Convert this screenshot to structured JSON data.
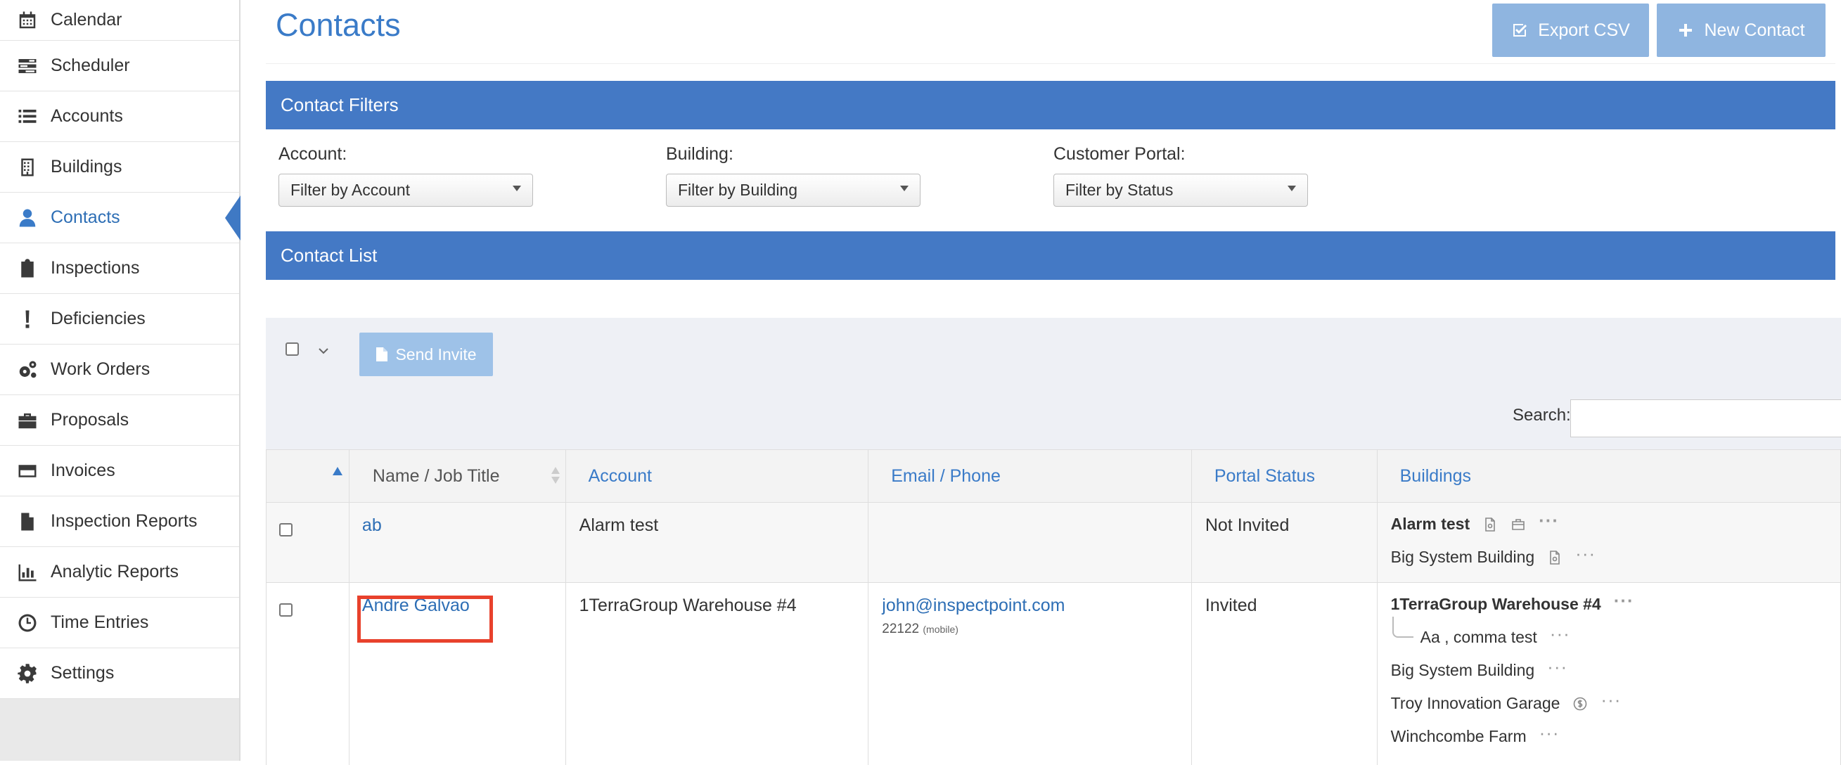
{
  "sidebar": {
    "items": [
      {
        "label": "Calendar",
        "icon": "calendar-icon"
      },
      {
        "label": "Scheduler",
        "icon": "scheduler-icon"
      },
      {
        "label": "Accounts",
        "icon": "list-icon"
      },
      {
        "label": "Buildings",
        "icon": "building-icon"
      },
      {
        "label": "Contacts",
        "icon": "user-icon",
        "active": true
      },
      {
        "label": "Inspections",
        "icon": "clipboard-icon"
      },
      {
        "label": "Deficiencies",
        "icon": "exclamation-icon"
      },
      {
        "label": "Work Orders",
        "icon": "gears-icon"
      },
      {
        "label": "Proposals",
        "icon": "briefcase-icon"
      },
      {
        "label": "Invoices",
        "icon": "credit-card-icon"
      },
      {
        "label": "Inspection Reports",
        "icon": "file-icon"
      },
      {
        "label": "Analytic Reports",
        "icon": "bar-chart-icon"
      },
      {
        "label": "Time Entries",
        "icon": "clock-icon"
      },
      {
        "label": "Settings",
        "icon": "gear-icon"
      }
    ]
  },
  "header": {
    "title": "Contacts",
    "export_label": "Export CSV",
    "new_label": "New Contact"
  },
  "filters": {
    "panel_title": "Contact Filters",
    "account": {
      "label": "Account:",
      "value": "Filter by Account"
    },
    "building": {
      "label": "Building:",
      "value": "Filter by Building"
    },
    "portal": {
      "label": "Customer Portal:",
      "value": "Filter by Status"
    }
  },
  "list": {
    "panel_title": "Contact List",
    "send_invite_label": "Send Invite",
    "search_label": "Search:",
    "search_value": "",
    "columns": [
      "Name / Job Title",
      "Account",
      "Email / Phone",
      "Portal Status",
      "Buildings"
    ],
    "rows": [
      {
        "name": "ab",
        "account": "Alarm test",
        "email": "",
        "phone": "",
        "phone_type": "",
        "portal_status": "Not Invited",
        "buildings": [
          "Alarm test",
          "Big System Building"
        ]
      },
      {
        "name": "Andre Galvao",
        "account": "1TerraGroup Warehouse #4",
        "email": "john@inspectpoint.com",
        "phone": "22122",
        "phone_type": "(mobile)",
        "portal_status": "Invited",
        "buildings": [
          "1TerraGroup Warehouse #4",
          "Aa , comma test",
          "Big System Building",
          "Troy Innovation Garage",
          "Winchcombe Farm"
        ]
      }
    ]
  },
  "colors": {
    "accent": "#3a7bc8",
    "panel_header": "#4479c5",
    "button": "#8fb5e0",
    "highlight": "#e8412c"
  }
}
